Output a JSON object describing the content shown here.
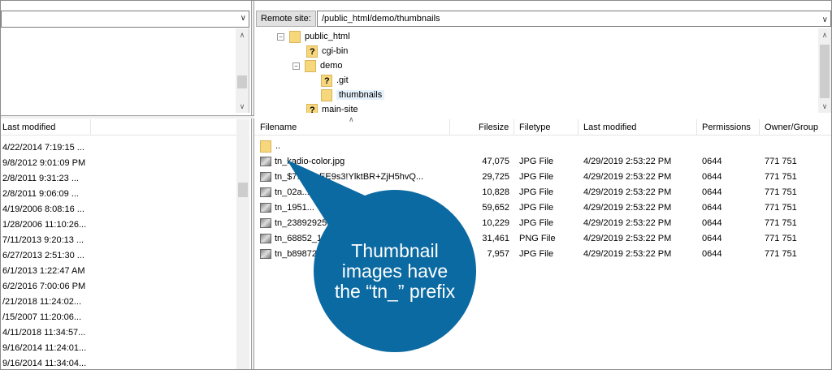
{
  "left": {
    "column_header": "Last modified",
    "rows": [
      "4/22/2014 7:19:15 ...",
      "9/8/2012 9:01:09 PM",
      "2/8/2011 9:31:23 ...",
      "2/8/2011 9:06:09 ...",
      "4/19/2006 8:08:16 ...",
      "1/28/2006 11:10:26...",
      "7/11/2013 9:20:13 ...",
      "6/27/2013 2:51:30 ...",
      "6/1/2013 1:22:47 AM",
      "6/2/2016 7:00:06 PM",
      "/21/2018 11:24:02...",
      "/15/2007 11:20:06...",
      "4/11/2018 11:34:57...",
      "9/16/2014 11:24:01...",
      "9/16/2014 11:34:04..."
    ]
  },
  "remote": {
    "label": "Remote site:",
    "path": "/public_html/demo/thumbnails",
    "tree": [
      {
        "label": "public_html",
        "icon": "folder-icon"
      },
      {
        "label": "cgi-bin",
        "icon": "unknown-folder-icon"
      },
      {
        "label": "demo",
        "icon": "folder-icon"
      },
      {
        "label": ".git",
        "icon": "unknown-folder-icon"
      },
      {
        "label": "thumbnails",
        "icon": "folder-icon"
      },
      {
        "label": "main-site",
        "icon": "unknown-folder-icon"
      }
    ]
  },
  "files": {
    "headers": {
      "filename": "Filename",
      "filesize": "Filesize",
      "filetype": "Filetype",
      "modified": "Last modified",
      "permissions": "Permissions",
      "owner": "Owner/Group"
    },
    "parent": "..",
    "rows": [
      {
        "name": "tn_kadio-color.jpg",
        "size": "47,075",
        "type": "JPG File",
        "modified": "4/29/2019 2:53:22 PM",
        "perm": "0644",
        "owner": "771 751"
      },
      {
        "name": "tn_$7...Z.!zEE9s3!YlktBR+ZjH5hvQ...",
        "size": "29,725",
        "type": "JPG File",
        "modified": "4/29/2019 2:53:22 PM",
        "perm": "0644",
        "owner": "771 751"
      },
      {
        "name": "tn_02a...ie.png",
        "size": "10,828",
        "type": "JPG File",
        "modified": "4/29/2019 2:53:22 PM",
        "perm": "0644",
        "owner": "771 751"
      },
      {
        "name": "tn_1951...",
        "size": "59,652",
        "type": "JPG File",
        "modified": "4/29/2019 2:53:22 PM",
        "perm": "0644",
        "owner": "771 751"
      },
      {
        "name": "tn_23892925...",
        "size": "10,229",
        "type": "JPG File",
        "modified": "4/29/2019 2:53:22 PM",
        "perm": "0644",
        "owner": "771 751"
      },
      {
        "name": "tn_68852_1...",
        "size": "31,461",
        "type": "PNG File",
        "modified": "4/29/2019 2:53:22 PM",
        "perm": "0644",
        "owner": "771 751"
      },
      {
        "name": "tn_b89872...",
        "size": "7,957",
        "type": "JPG File",
        "modified": "4/29/2019 2:53:22 PM",
        "perm": "0644",
        "owner": "771 751"
      }
    ]
  },
  "callout": {
    "text": "Thumbnail images have the “tn_” prefix",
    "color": "#0b6aa2"
  }
}
